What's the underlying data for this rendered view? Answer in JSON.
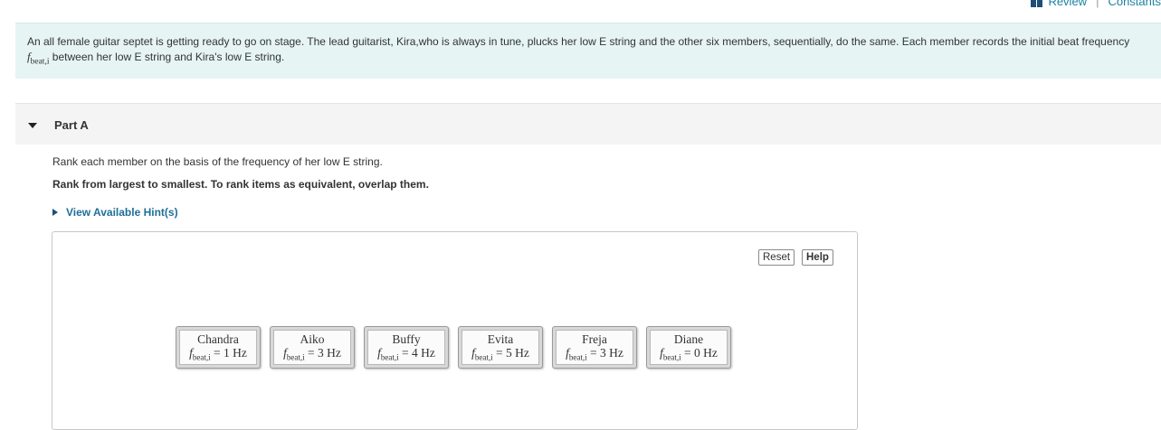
{
  "top_links": {
    "review": "Review",
    "constants": "Constants"
  },
  "intro": {
    "text_before": "An all female guitar septet is getting ready to go on stage. The lead guitarist, Kira,who is always in tune, plucks her low E string and the other six members, sequentially, do the same. Each member records the initial beat frequency ",
    "symbol": "f",
    "subscript": "beat,i",
    "text_after": " between her low E string and Kira's low E string."
  },
  "part": {
    "title": "Part A"
  },
  "instruction": "Rank each member on the basis of the frequency of her low E string.",
  "instruction_bold": "Rank from largest to smallest. To rank items as equivalent, overlap them.",
  "hint_label": "View Available Hint(s)",
  "buttons": {
    "reset": "Reset",
    "help": "Help"
  },
  "items": [
    {
      "name": "Chandra",
      "value": " = 1 Hz"
    },
    {
      "name": "Aiko",
      "value": " = 3 Hz"
    },
    {
      "name": "Buffy",
      "value": " = 4 Hz"
    },
    {
      "name": "Evita",
      "value": " = 5 Hz"
    },
    {
      "name": "Freja",
      "value": " = 3 Hz"
    },
    {
      "name": "Diane",
      "value": " = 0 Hz"
    }
  ],
  "item_symbol": "f",
  "item_subscript": "beat,i",
  "colors": {
    "intro_bg": "#e6f4f4",
    "link": "#1a7fa3",
    "hint": "#1f6f9a",
    "part_bg": "#f4f4f4"
  },
  "icons": {
    "review": "book-icon",
    "part_toggle": "caret-down-icon",
    "hint_toggle": "caret-right-icon"
  }
}
